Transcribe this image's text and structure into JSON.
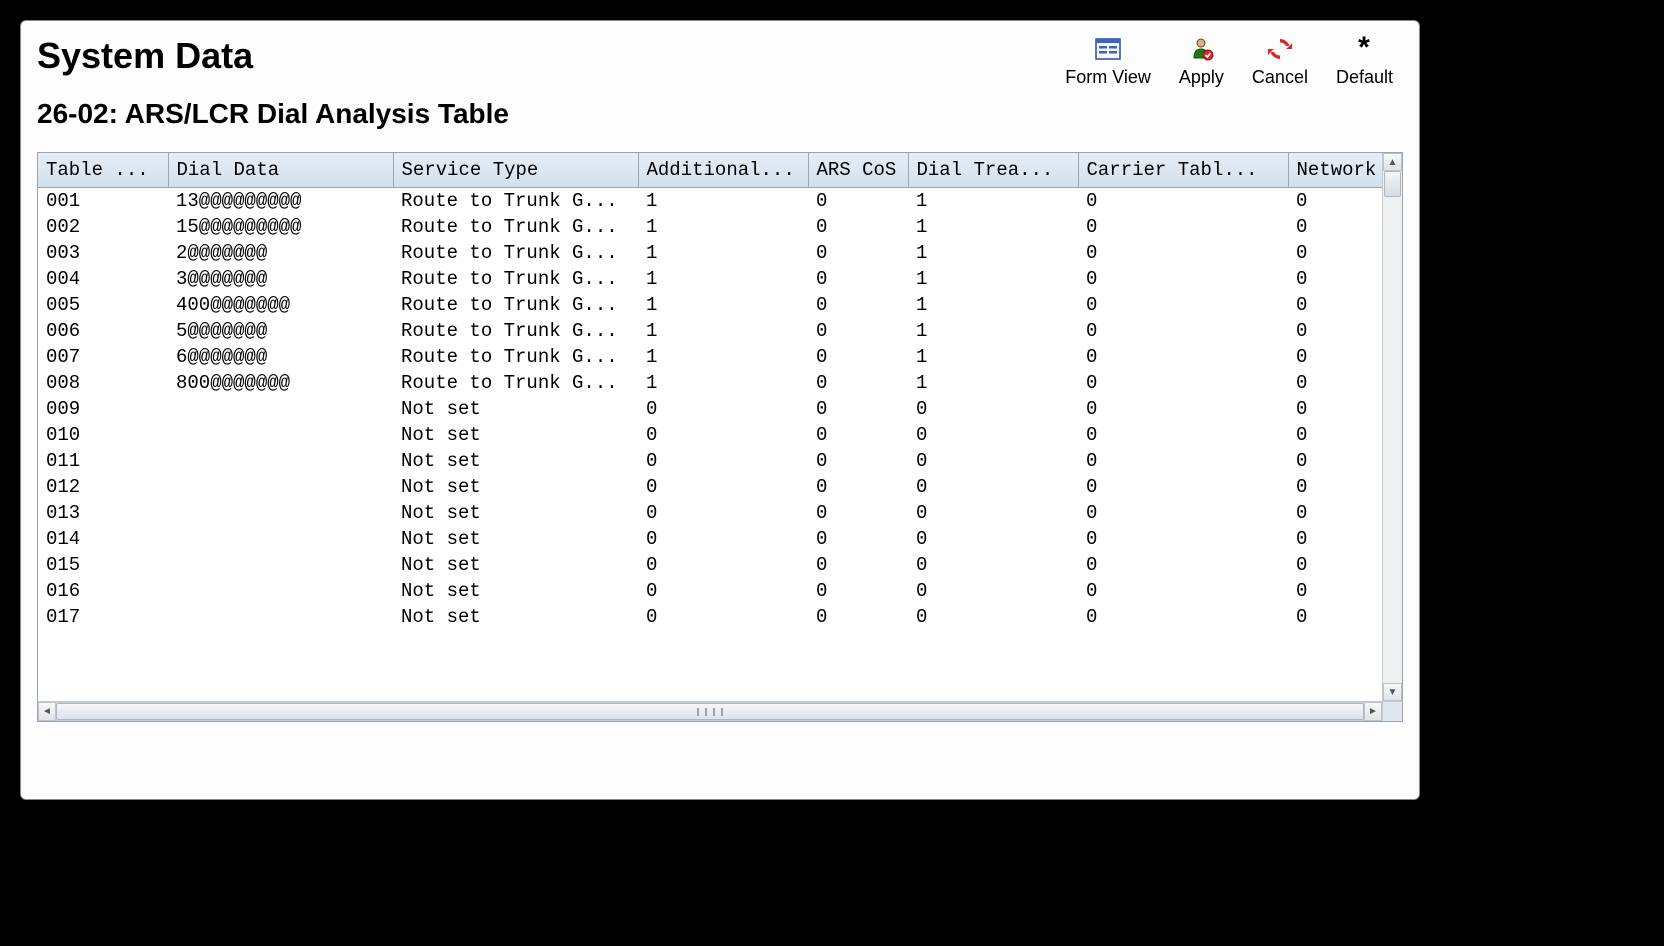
{
  "header": {
    "title": "System Data",
    "subtitle": "26-02: ARS/LCR Dial Analysis Table"
  },
  "toolbar": {
    "form_view": "Form View",
    "apply": "Apply",
    "cancel": "Cancel",
    "default": "Default"
  },
  "table": {
    "headers": {
      "table": "Table ...",
      "dial": "Dial Data",
      "service": "Service Type",
      "additional": "Additional...",
      "cos": "ARS CoS",
      "trea": "Dial Trea...",
      "carrier": "Carrier Tabl...",
      "network": "Network"
    },
    "rows": [
      {
        "table": "001",
        "dial": "13@@@@@@@@@",
        "service": "Route to Trunk G...",
        "add": "1",
        "cos": "0",
        "trea": "1",
        "carr": "0",
        "net": "0"
      },
      {
        "table": "002",
        "dial": "15@@@@@@@@@",
        "service": "Route to Trunk G...",
        "add": "1",
        "cos": "0",
        "trea": "1",
        "carr": "0",
        "net": "0"
      },
      {
        "table": "003",
        "dial": "2@@@@@@@",
        "service": "Route to Trunk G...",
        "add": "1",
        "cos": "0",
        "trea": "1",
        "carr": "0",
        "net": "0"
      },
      {
        "table": "004",
        "dial": "3@@@@@@@",
        "service": "Route to Trunk G...",
        "add": "1",
        "cos": "0",
        "trea": "1",
        "carr": "0",
        "net": "0"
      },
      {
        "table": "005",
        "dial": "400@@@@@@@",
        "service": "Route to Trunk G...",
        "add": "1",
        "cos": "0",
        "trea": "1",
        "carr": "0",
        "net": "0"
      },
      {
        "table": "006",
        "dial": "5@@@@@@@",
        "service": "Route to Trunk G...",
        "add": "1",
        "cos": "0",
        "trea": "1",
        "carr": "0",
        "net": "0"
      },
      {
        "table": "007",
        "dial": "6@@@@@@@",
        "service": "Route to Trunk G...",
        "add": "1",
        "cos": "0",
        "trea": "1",
        "carr": "0",
        "net": "0"
      },
      {
        "table": "008",
        "dial": "800@@@@@@@",
        "service": "Route to Trunk G...",
        "add": "1",
        "cos": "0",
        "trea": "1",
        "carr": "0",
        "net": "0"
      },
      {
        "table": "009",
        "dial": "",
        "service": "Not set",
        "add": "0",
        "cos": "0",
        "trea": "0",
        "carr": "0",
        "net": "0"
      },
      {
        "table": "010",
        "dial": "",
        "service": "Not set",
        "add": "0",
        "cos": "0",
        "trea": "0",
        "carr": "0",
        "net": "0"
      },
      {
        "table": "011",
        "dial": "",
        "service": "Not set",
        "add": "0",
        "cos": "0",
        "trea": "0",
        "carr": "0",
        "net": "0"
      },
      {
        "table": "012",
        "dial": "",
        "service": "Not set",
        "add": "0",
        "cos": "0",
        "trea": "0",
        "carr": "0",
        "net": "0"
      },
      {
        "table": "013",
        "dial": "",
        "service": "Not set",
        "add": "0",
        "cos": "0",
        "trea": "0",
        "carr": "0",
        "net": "0"
      },
      {
        "table": "014",
        "dial": "",
        "service": "Not set",
        "add": "0",
        "cos": "0",
        "trea": "0",
        "carr": "0",
        "net": "0"
      },
      {
        "table": "015",
        "dial": "",
        "service": "Not set",
        "add": "0",
        "cos": "0",
        "trea": "0",
        "carr": "0",
        "net": "0"
      },
      {
        "table": "016",
        "dial": "",
        "service": "Not set",
        "add": "0",
        "cos": "0",
        "trea": "0",
        "carr": "0",
        "net": "0"
      },
      {
        "table": "017",
        "dial": "",
        "service": "Not set",
        "add": "0",
        "cos": "0",
        "trea": "0",
        "carr": "0",
        "net": "0"
      }
    ]
  }
}
